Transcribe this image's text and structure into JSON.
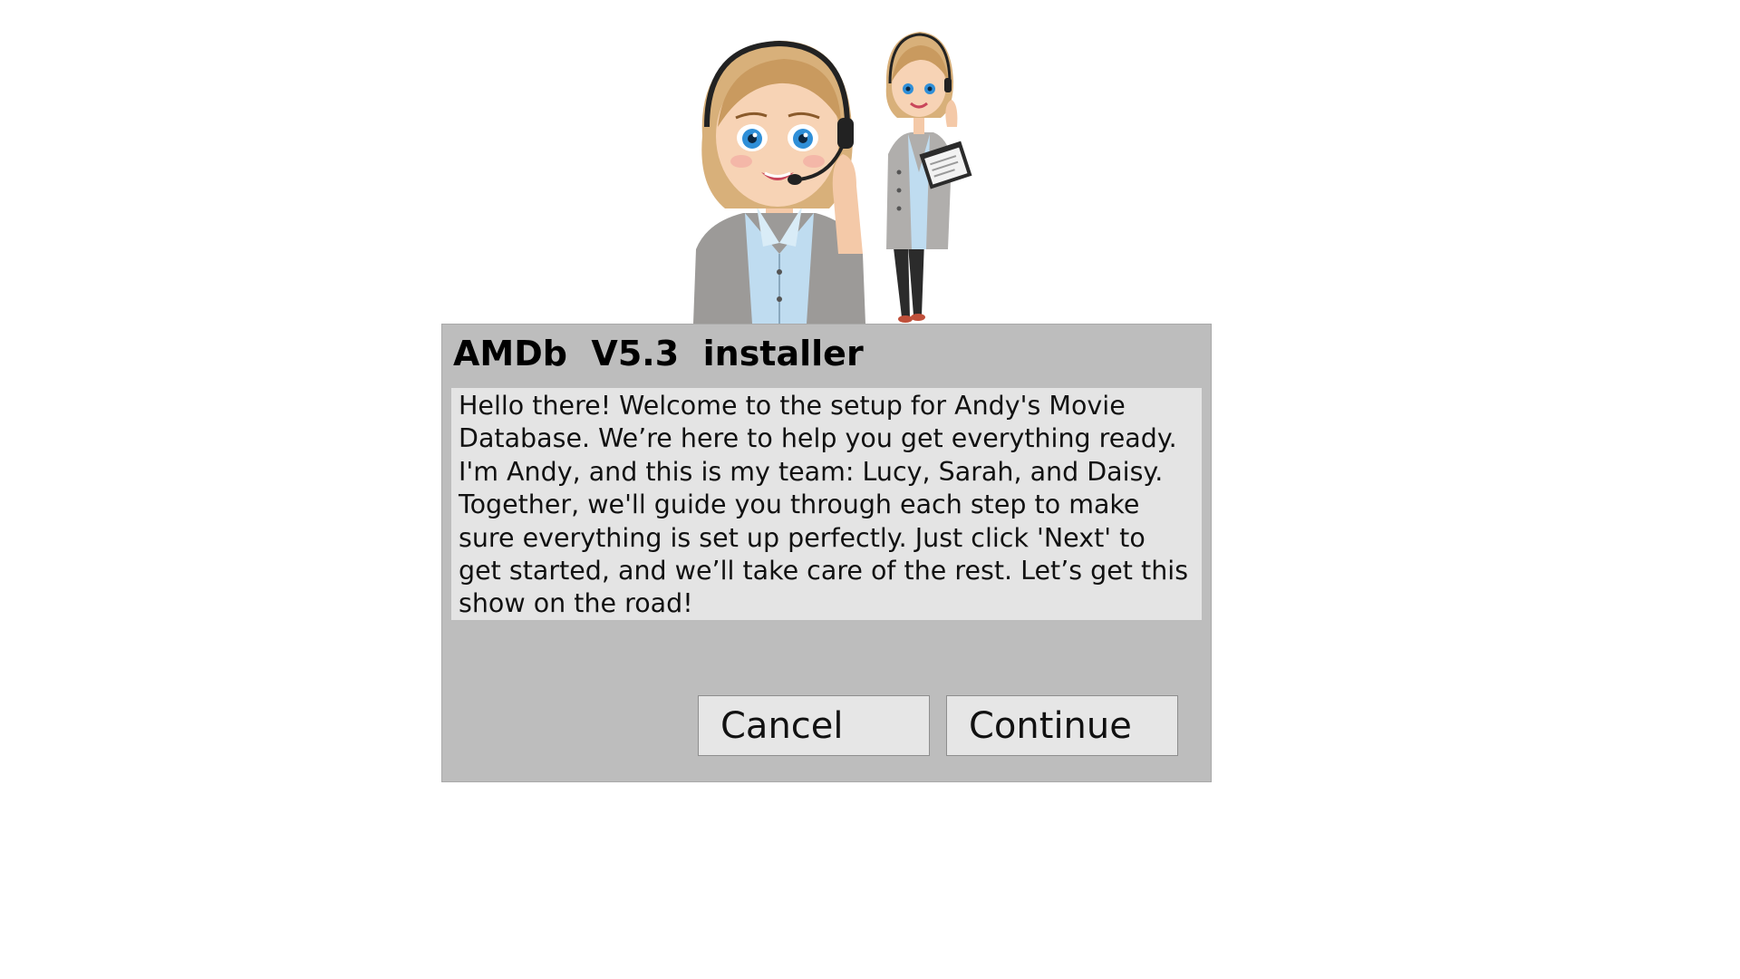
{
  "dialog": {
    "title": "AMDb  V5.3  installer",
    "message": "Hello there! Welcome to the setup for Andy's Movie Database. We’re here to help you get everything ready. I'm Andy, and this is my team: Lucy, Sarah, and Daisy. Together, we'll guide you through each step to make sure everything is set up perfectly. Just click 'Next' to get started, and we’ll take care of the rest. Let’s get this show on the road!",
    "cancel_label": "Cancel",
    "continue_label": "Continue"
  },
  "colors": {
    "dialog_bg": "#bdbdbd",
    "message_bg": "#e4e4e4",
    "button_bg": "#e6e6e6",
    "hair": "#d8b07a",
    "eyes": "#2f8fd8",
    "shirt": "#bfdcf0",
    "cardigan": "#9c9a98"
  },
  "illustration": {
    "characters": [
      "support-agent-portrait",
      "support-agent-full-body-with-clipboard"
    ]
  }
}
